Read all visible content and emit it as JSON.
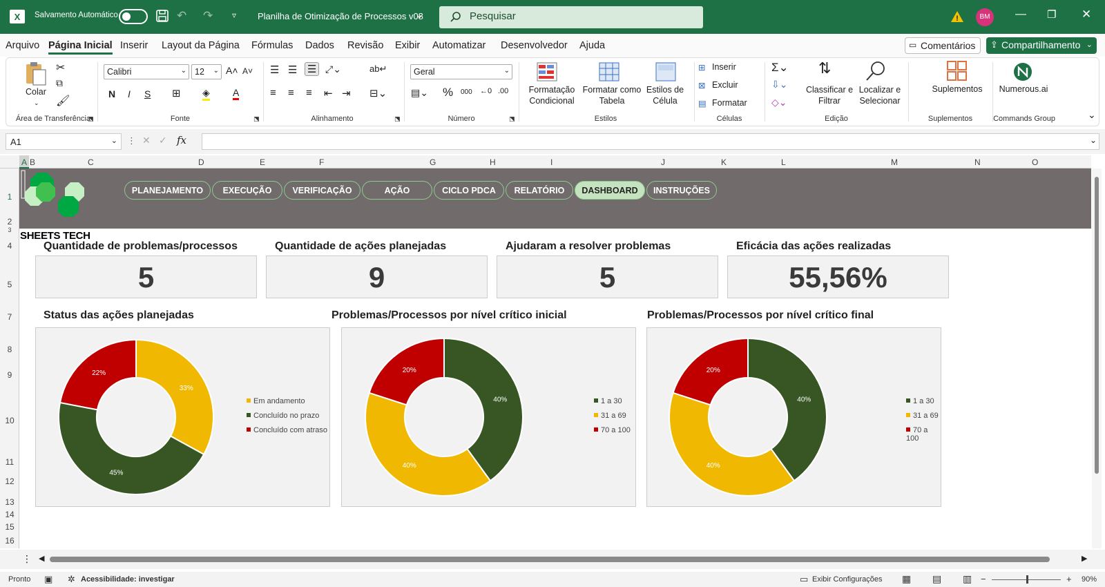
{
  "titlebar": {
    "autosave_label": "Salvamento Automático",
    "doc_title": "Planilha de Otimização de Processos v08",
    "search_placeholder": "Pesquisar",
    "avatar_initials": "BM"
  },
  "menu": {
    "items": [
      "Arquivo",
      "Página Inicial",
      "Inserir",
      "Layout da Página",
      "Fórmulas",
      "Dados",
      "Revisão",
      "Exibir",
      "Automatizar",
      "Desenvolvedor",
      "Ajuda"
    ],
    "active": "Página Inicial",
    "comments": "Comentários",
    "share": "Compartilhamento"
  },
  "ribbon": {
    "paste": "Colar",
    "font_name": "Calibri",
    "font_size": "12",
    "number_format": "Geral",
    "cond_format": "Formatação Condicional",
    "format_table": "Formatar como Tabela",
    "cell_styles": "Estilos de Célula",
    "insert": "Inserir",
    "delete": "Excluir",
    "format": "Formatar",
    "sort_filter": "Classificar e Filtrar",
    "find_select": "Localizar e Selecionar",
    "addins": "Suplementos",
    "numerous": "Numerous.ai",
    "groups": {
      "clipboard": "Área de Transferência",
      "font": "Fonte",
      "alignment": "Alinhamento",
      "number": "Número",
      "styles": "Estilos",
      "cells": "Células",
      "editing": "Edição",
      "addins": "Suplementos",
      "commands": "Commands Group"
    }
  },
  "formula": {
    "namebox": "A1",
    "fx": "fx",
    "value": ""
  },
  "columns": [
    "A",
    "B",
    "C",
    "D",
    "E",
    "F",
    "G",
    "H",
    "I",
    "J",
    "K",
    "L",
    "M",
    "N",
    "O"
  ],
  "rows": [
    "1",
    "2",
    "3",
    "4",
    "5",
    "7",
    "8",
    "9",
    "10",
    "11",
    "12",
    "13",
    "14",
    "15",
    "16"
  ],
  "banner": {
    "tabs": [
      "PLANEJAMENTO",
      "EXECUÇÃO",
      "VERIFICAÇÃO",
      "AÇÃO",
      "CICLO PDCA",
      "RELATÓRIO",
      "DASHBOARD",
      "INSTRUÇÕES"
    ],
    "active": "DASHBOARD",
    "brand": "SHEETS TECH"
  },
  "kpis": [
    {
      "title": "Quantidade de problemas/processos",
      "value": "5"
    },
    {
      "title": "Quantidade de ações planejadas",
      "value": "9"
    },
    {
      "title": "Ajudaram a resolver problemas",
      "value": "5"
    },
    {
      "title": "Eficácia das ações realizadas",
      "value": "55,56%"
    }
  ],
  "colors": {
    "yellow": "#f0b800",
    "green": "#375623",
    "red": "#c00000",
    "excel_green": "#1e7145"
  },
  "chart_data": [
    {
      "type": "pie",
      "title": "Status das ações planejadas",
      "categories": [
        "Em andamento",
        "Concluído no prazo",
        "Concluído com atraso"
      ],
      "values": [
        33,
        45,
        22
      ],
      "labels": [
        "33%",
        "45%",
        "22%"
      ],
      "colors": [
        "#f0b800",
        "#375623",
        "#c00000"
      ]
    },
    {
      "type": "pie",
      "title": "Problemas/Processos por nível crítico inicial",
      "categories": [
        "1 a 30",
        "31 a 69",
        "70 a 100"
      ],
      "values": [
        40,
        40,
        20
      ],
      "labels": [
        "40%",
        "40%",
        "20%"
      ],
      "colors": [
        "#375623",
        "#f0b800",
        "#c00000"
      ]
    },
    {
      "type": "pie",
      "title": "Problemas/Processos por nível crítico final",
      "categories": [
        "1 a 30",
        "31 a 69",
        "70 a 100"
      ],
      "values": [
        40,
        40,
        20
      ],
      "labels": [
        "40%",
        "40%",
        "20%"
      ],
      "colors": [
        "#375623",
        "#f0b800",
        "#c00000"
      ]
    }
  ],
  "status": {
    "ready": "Pronto",
    "accessibility": "Acessibilidade: investigar",
    "display_settings": "Exibir Configurações",
    "zoom": "90%"
  }
}
